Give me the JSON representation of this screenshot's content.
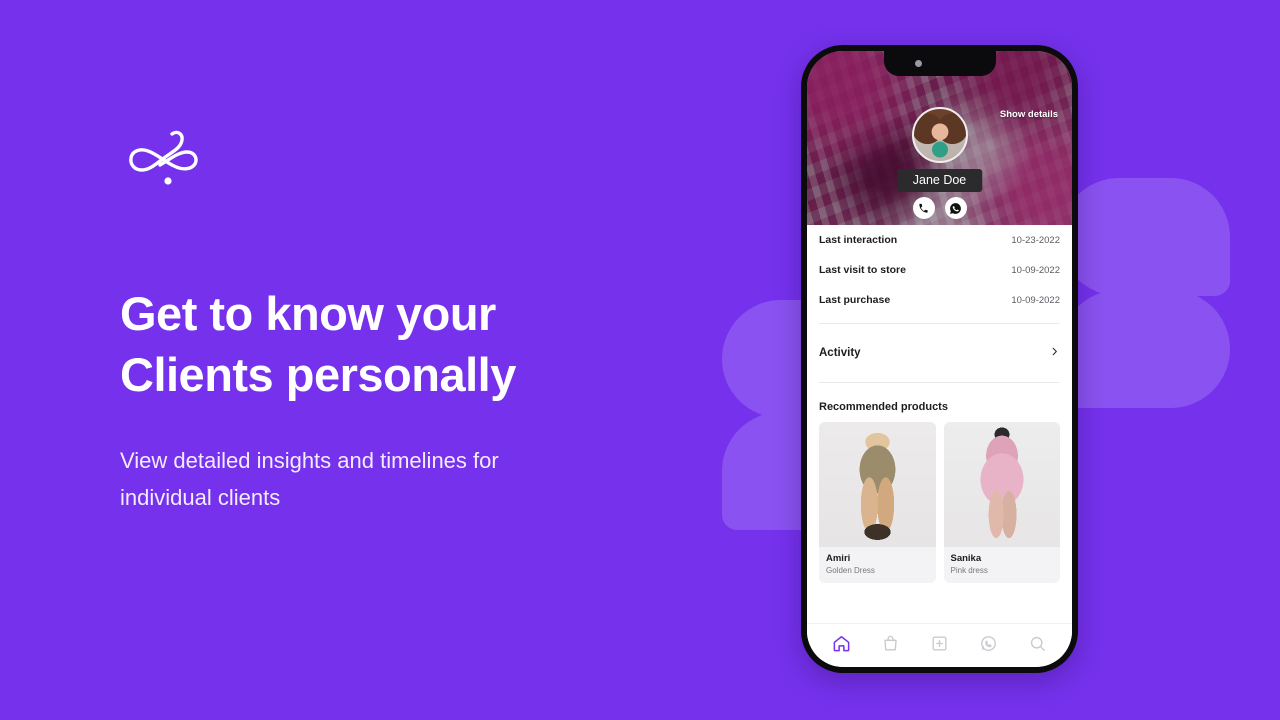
{
  "theme": {
    "background": "#7531ec",
    "decor_shape": "#8a52f0",
    "accent": "#7531ec",
    "text_on_dark": "#ffffff",
    "subhead": "#f2ebfe"
  },
  "hero": {
    "logo_name": "brand-flourish-logo",
    "headline_line1": "Get to know your",
    "headline_line2": "Clients personally",
    "subhead_line1": "View detailed insights and timelines for",
    "subhead_line2": "individual clients"
  },
  "phone": {
    "header": {
      "show_details_label": "Show details",
      "client_name": "Jane Doe",
      "avatar_name": "client-avatar",
      "quick_actions": [
        {
          "name": "call-button",
          "icon": "phone-icon"
        },
        {
          "name": "whatsapp-button",
          "icon": "whatsapp-icon"
        }
      ]
    },
    "details": [
      {
        "label": "Last interaction",
        "value": "10-23-2022"
      },
      {
        "label": "Last visit to store",
        "value": "10-09-2022"
      },
      {
        "label": "Last purchase",
        "value": "10-09-2022"
      }
    ],
    "activity": {
      "label": "Activity",
      "chevron_icon": "chevron-right-icon"
    },
    "recommended": {
      "title": "Recommended products",
      "products": [
        {
          "name": "Amiri",
          "desc": "Golden Dress"
        },
        {
          "name": "Sanika",
          "desc": "Pink dress"
        }
      ]
    },
    "nav": [
      {
        "name": "nav-home",
        "icon": "home-icon",
        "active": true
      },
      {
        "name": "nav-bag",
        "icon": "bag-icon",
        "active": false
      },
      {
        "name": "nav-add",
        "icon": "plus-square-icon",
        "active": false
      },
      {
        "name": "nav-whatsapp",
        "icon": "whatsapp-icon",
        "active": false
      },
      {
        "name": "nav-search",
        "icon": "search-icon",
        "active": false
      }
    ]
  }
}
